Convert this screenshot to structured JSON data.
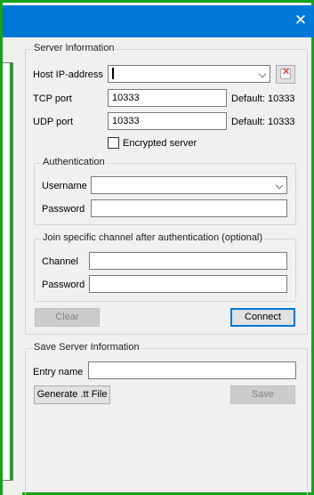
{
  "window": {
    "close_glyph": "✕",
    "accent_color": "#0078d7",
    "frame_color": "#17a21a"
  },
  "server_info": {
    "legend": "Server Information",
    "host_label": "Host IP-address",
    "host_value": "",
    "tcp_label": "TCP port",
    "tcp_value": "10333",
    "tcp_default": "Default: 10333",
    "udp_label": "UDP port",
    "udp_value": "10333",
    "udp_default": "Default: 10333",
    "encrypted_label": "Encrypted server",
    "encrypted_checked": false
  },
  "authentication": {
    "legend": "Authentication",
    "username_label": "Username",
    "username_value": "",
    "password_label": "Password",
    "password_value": ""
  },
  "join_channel": {
    "legend": "Join specific channel after authentication (optional)",
    "channel_label": "Channel",
    "channel_value": "",
    "password_label": "Password",
    "password_value": ""
  },
  "actions": {
    "clear_label": "Clear",
    "connect_label": "Connect"
  },
  "save_info": {
    "legend": "Save Server Information",
    "entry_label": "Entry name",
    "entry_value": "",
    "generate_label": "Generate .tt File",
    "save_label": "Save"
  }
}
